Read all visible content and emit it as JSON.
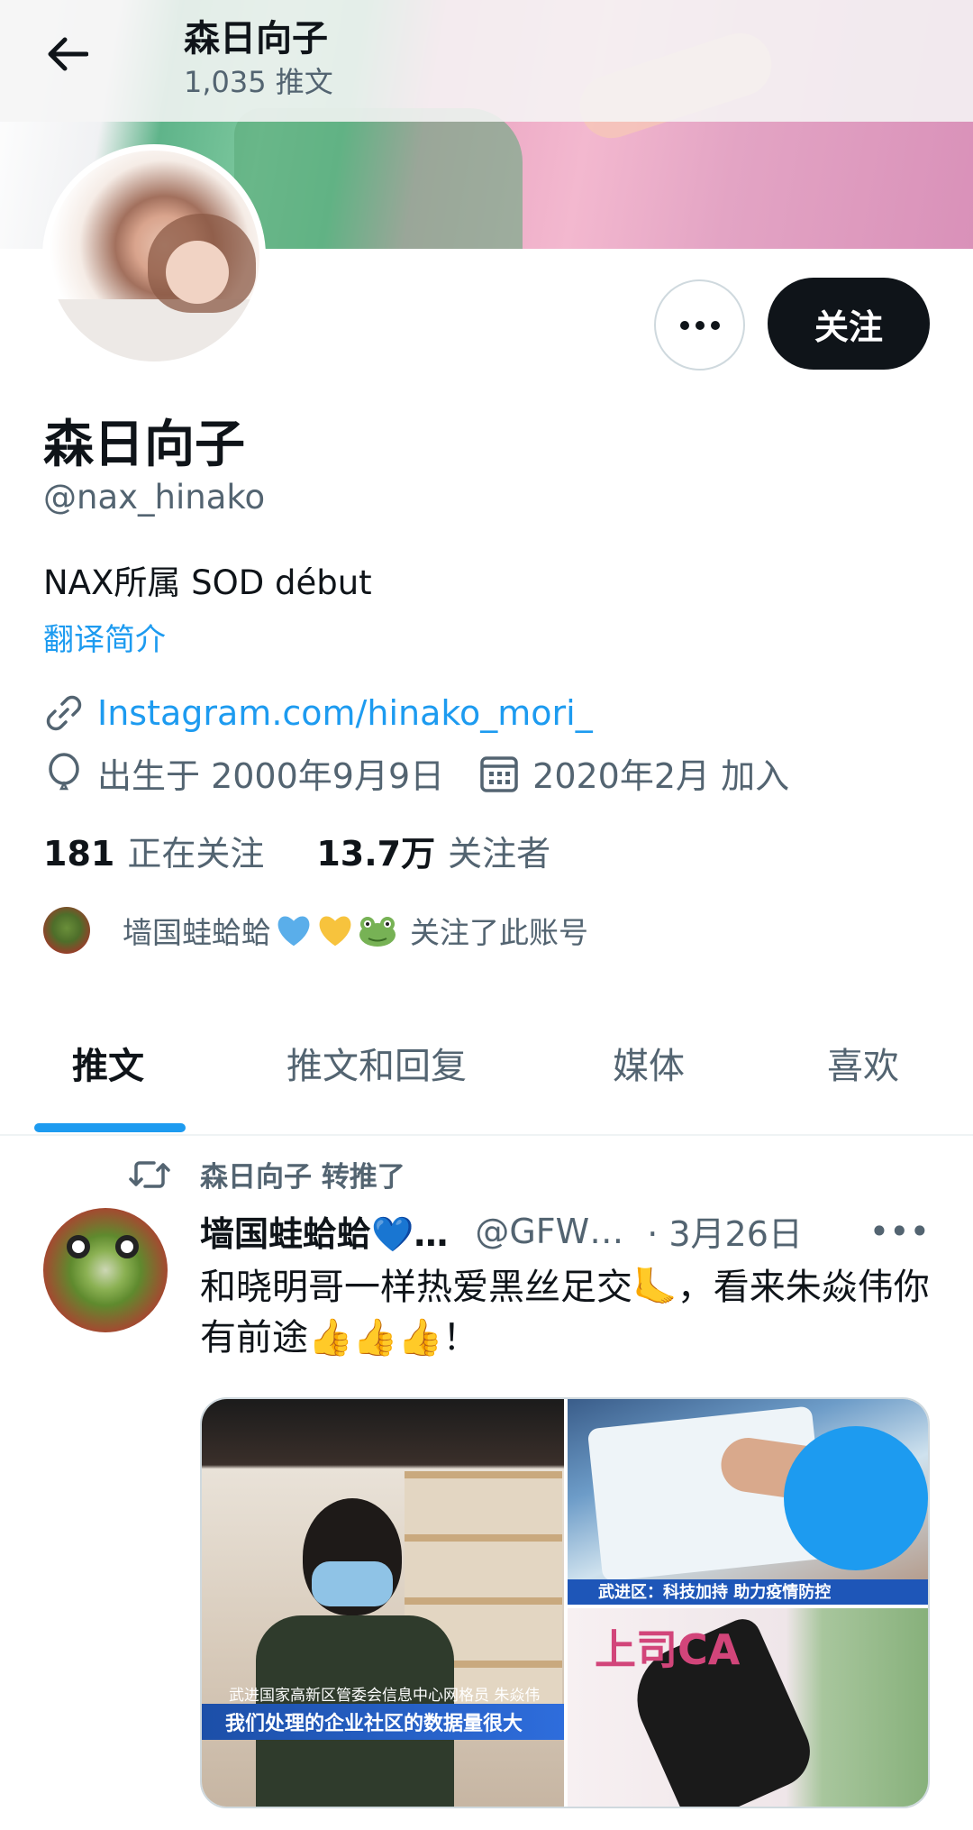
{
  "header": {
    "title": "森日向子",
    "tweet_count": "1,035 推文"
  },
  "actions": {
    "more_label": "•••",
    "follow_label": "关注"
  },
  "profile": {
    "display_name": "森日向子",
    "handle": "@nax_hinako",
    "bio": "NAX所属 SOD début",
    "translate_label": "翻译简介",
    "link": "Instagram.com/hinako_mori_",
    "birth": "出生于 2000年9月9日",
    "joined": "2020年2月 加入",
    "following_count": "181",
    "following_label": "正在关注",
    "followers_count": "13.7万",
    "followers_label": "关注者",
    "followed_by_name": "墙国蛙蛤蛤",
    "followed_by_suffix": "关注了此账号"
  },
  "tabs": [
    {
      "label": "推文",
      "active": true
    },
    {
      "label": "推文和回复",
      "active": false
    },
    {
      "label": "媒体",
      "active": false
    },
    {
      "label": "喜欢",
      "active": false
    }
  ],
  "tweet": {
    "retweet_label": "森日向子 转推了",
    "author_name": "墙国蛙蛤蛤💙…",
    "author_handle": "@GFW…",
    "date": "· 3月26日",
    "more_label": "•••",
    "text": "和晓明哥一样热爱黑丝足交🦶，看来朱焱伟你有前途👍👍👍！",
    "media": {
      "image1_caption_small": "武进国家高新区管委会信息中心网格员 朱焱伟",
      "image1_caption": "我们处理的企业社区的数据量很大",
      "image2_caption": "武进区：科技加持 助力疫情防控",
      "image3_title": "上司CA"
    }
  },
  "colors": {
    "accent": "#1d9bf0",
    "text_primary": "#0f1419",
    "text_secondary": "#536471"
  }
}
